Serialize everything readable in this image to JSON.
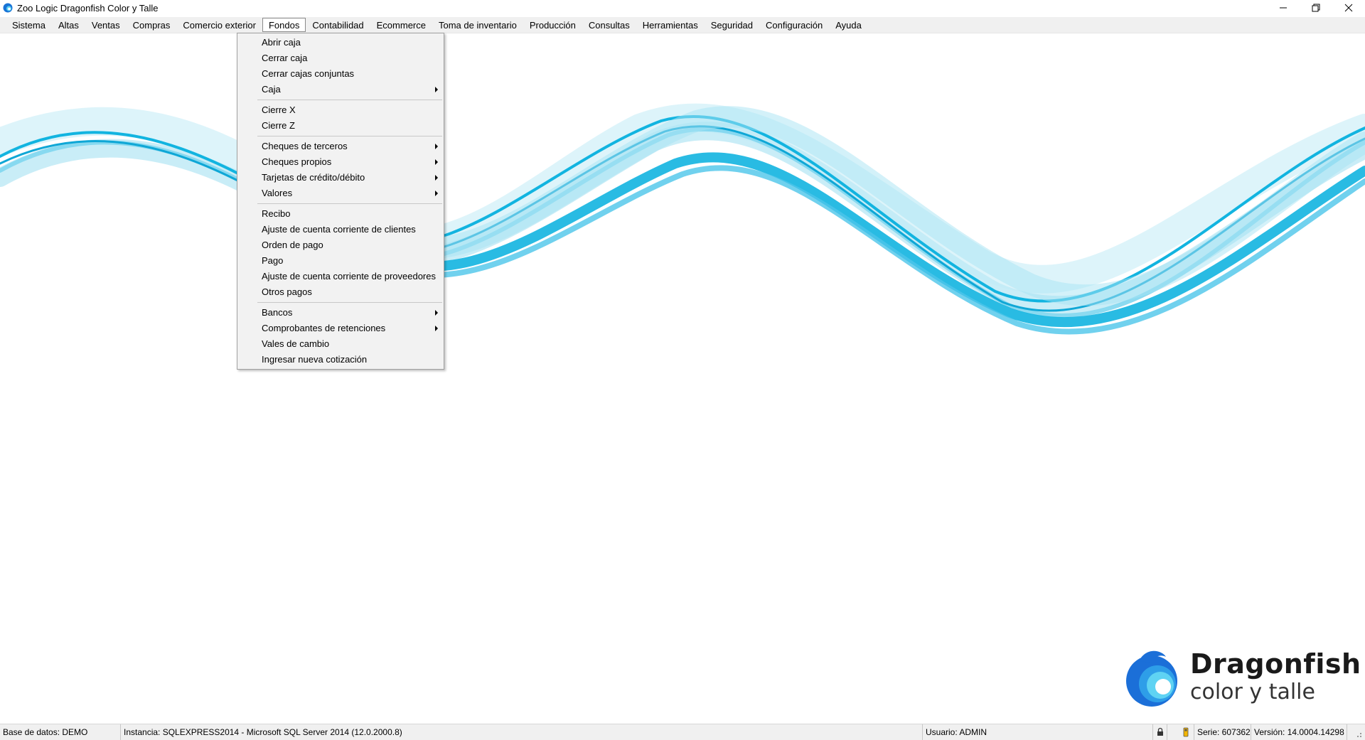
{
  "window": {
    "title": "Zoo Logic Dragonfish Color y Talle",
    "icon": "dragonfish-app-icon"
  },
  "menubar": [
    "Sistema",
    "Altas",
    "Ventas",
    "Compras",
    "Comercio exterior",
    "Fondos",
    "Contabilidad",
    "Ecommerce",
    "Toma de inventario",
    "Producción",
    "Consultas",
    "Herramientas",
    "Seguridad",
    "Configuración",
    "Ayuda"
  ],
  "open_menu": "Fondos",
  "dropdown": {
    "groups": [
      [
        {
          "label": "Abrir caja",
          "submenu": false
        },
        {
          "label": "Cerrar caja",
          "submenu": false
        },
        {
          "label": "Cerrar cajas conjuntas",
          "submenu": false
        },
        {
          "label": "Caja",
          "submenu": true
        }
      ],
      [
        {
          "label": "Cierre X",
          "submenu": false
        },
        {
          "label": "Cierre Z",
          "submenu": false
        }
      ],
      [
        {
          "label": "Cheques de terceros",
          "submenu": true
        },
        {
          "label": "Cheques propios",
          "submenu": true
        },
        {
          "label": "Tarjetas de crédito/débito",
          "submenu": true
        },
        {
          "label": "Valores",
          "submenu": true
        }
      ],
      [
        {
          "label": "Recibo",
          "submenu": false
        },
        {
          "label": "Ajuste de cuenta corriente de clientes",
          "submenu": false
        },
        {
          "label": "Orden de pago",
          "submenu": false
        },
        {
          "label": "Pago",
          "submenu": false
        },
        {
          "label": "Ajuste de cuenta corriente de proveedores",
          "submenu": false
        },
        {
          "label": "Otros pagos",
          "submenu": false
        }
      ],
      [
        {
          "label": "Bancos",
          "submenu": true
        },
        {
          "label": "Comprobantes de retenciones",
          "submenu": true
        },
        {
          "label": "Vales de cambio",
          "submenu": false
        },
        {
          "label": "Ingresar nueva cotización",
          "submenu": false
        }
      ]
    ]
  },
  "logo": {
    "name": "Dragonfish",
    "tagline": "color y talle"
  },
  "statusbar": {
    "database": "Base de datos: DEMO",
    "instance": "Instancia: SQLEXPRESS2014 - Microsoft SQL Server 2014 (12.0.2000.8)",
    "user": "Usuario: ADMIN",
    "serial": "Serie: 607362",
    "version": "Versión: 14.0004.14298"
  },
  "colors": {
    "wave_primary": "#12b4e0",
    "wave_light": "#bfeaf6",
    "menubar_bg": "#f0f0f0",
    "dropdown_bg": "#f2f2f2"
  }
}
